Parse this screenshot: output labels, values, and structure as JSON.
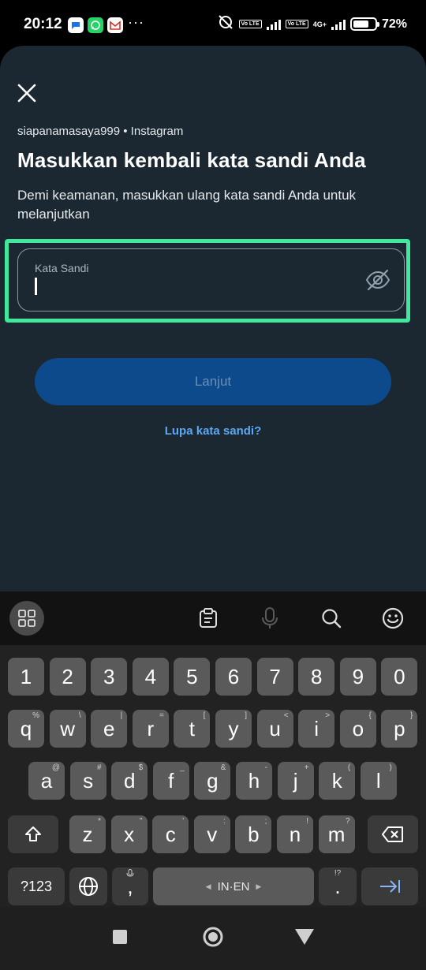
{
  "status_bar": {
    "time": "20:12",
    "notification_icons": [
      "messages-icon",
      "whatsapp-icon",
      "gmail-icon"
    ],
    "more": "···",
    "volte1": "Vo LTE",
    "volte2": "Vo LTE",
    "network": "4G+",
    "battery": "72%",
    "battery_level": 0.72
  },
  "sheet": {
    "account": "siapanamasaya999 • Instagram",
    "title": "Masukkan kembali kata sandi Anda",
    "subtitle": "Demi keamanan, masukkan ulang kata sandi Anda untuk melanjutkan",
    "password_label": "Kata Sandi",
    "password_value": "",
    "next_label": "Lanjut",
    "forgot_label": "Lupa kata sandi?"
  },
  "keyboard": {
    "numbers": [
      "1",
      "2",
      "3",
      "4",
      "5",
      "6",
      "7",
      "8",
      "9",
      "0"
    ],
    "row1": [
      {
        "k": "q",
        "h": "%"
      },
      {
        "k": "w",
        "h": "\\"
      },
      {
        "k": "e",
        "h": "|"
      },
      {
        "k": "r",
        "h": "="
      },
      {
        "k": "t",
        "h": "["
      },
      {
        "k": "y",
        "h": "]"
      },
      {
        "k": "u",
        "h": "<"
      },
      {
        "k": "i",
        "h": ">"
      },
      {
        "k": "o",
        "h": "{"
      },
      {
        "k": "p",
        "h": "}"
      }
    ],
    "row2": [
      {
        "k": "a",
        "h": "@"
      },
      {
        "k": "s",
        "h": "#"
      },
      {
        "k": "d",
        "h": "$"
      },
      {
        "k": "f",
        "h": "_"
      },
      {
        "k": "g",
        "h": "&"
      },
      {
        "k": "h",
        "h": "-"
      },
      {
        "k": "j",
        "h": "+"
      },
      {
        "k": "k",
        "h": "("
      },
      {
        "k": "l",
        "h": ")"
      }
    ],
    "row3": [
      {
        "k": "z",
        "h": "*"
      },
      {
        "k": "x",
        "h": "\""
      },
      {
        "k": "c",
        "h": "'"
      },
      {
        "k": "v",
        "h": ":"
      },
      {
        "k": "b",
        "h": ";"
      },
      {
        "k": "n",
        "h": "!"
      },
      {
        "k": "m",
        "h": "?"
      }
    ],
    "symbols_label": "?123",
    "comma": ",",
    "space_label": "IN·EN",
    "period": ".",
    "period_hint": "!?"
  },
  "colors": {
    "sheet_bg": "#1b2832",
    "highlight": "#3fe89a",
    "button_bg": "#0d4a8c",
    "link": "#5aa9f5"
  }
}
